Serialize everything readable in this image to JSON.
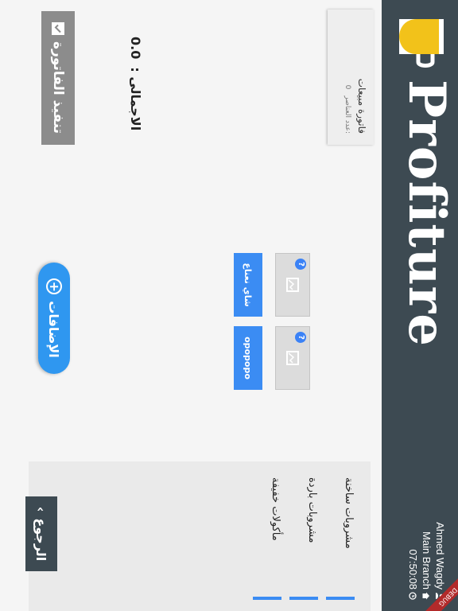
{
  "header": {
    "brand": "Profiture",
    "user_name": "Ahmed Wagdy",
    "branch": "Main Branch",
    "time": "07:50:08",
    "debug_label": "DEBUG"
  },
  "invoice": {
    "title": "فاتورة مبيعات",
    "count_label": "عدد العناصر:",
    "count_value": "0"
  },
  "products": [
    {
      "name": "شاي نعناع"
    },
    {
      "name": "opopopo"
    }
  ],
  "categories": [
    {
      "label": "مشروبات ساخنة"
    },
    {
      "label": "مشروبات باردة"
    },
    {
      "label": "مأكولات خفيفة"
    }
  ],
  "total": {
    "label": "الاجمالى :",
    "value": "0.0"
  },
  "buttons": {
    "execute_invoice": "تنفيذ الفاتورة",
    "additions": "الإضافات",
    "back": "الرجوع"
  },
  "colors": {
    "header_bg": "#3d4a52",
    "accent_blue": "#3b8cf3",
    "logo_yellow": "#f2c21a",
    "execute_gray": "#8c8c8c"
  }
}
